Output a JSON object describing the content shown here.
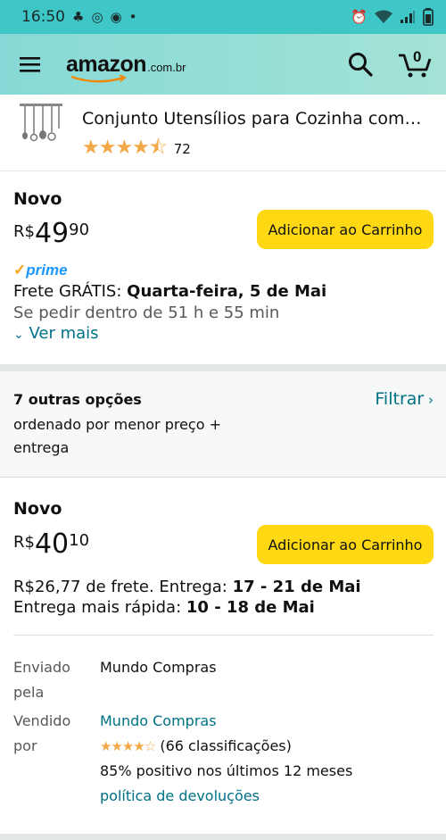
{
  "status_bar": {
    "time": "16:50"
  },
  "header": {
    "logo_main": "amazon",
    "logo_tld": ".com.br",
    "cart_count": "0"
  },
  "product": {
    "title": "Conjunto Utensílios para Cozinha com…",
    "rating_stars": "★★★★⯪",
    "rating_count": "72"
  },
  "offer1": {
    "condition": "Novo",
    "price_currency": "R$",
    "price_whole": "49",
    "price_fraction": "90",
    "cart_button": "Adicionar ao Carrinho",
    "prime_label": "prime",
    "shipping_prefix": "Frete GRÁTIS: ",
    "shipping_date": "Quarta-feira, 5 de Mai",
    "cutoff": "Se pedir dentro de 51 h e 55 min",
    "see_more": "Ver mais"
  },
  "other_options": {
    "title": "7 outras opções",
    "subtitle": "ordenado por menor preço + entrega",
    "filter": "Filtrar"
  },
  "offer2": {
    "condition": "Novo",
    "price_currency": "R$",
    "price_whole": "40",
    "price_fraction": "10",
    "cart_button": "Adicionar ao Carrinho",
    "shipping_prefix": "R$26,77 de frete. Entrega: ",
    "shipping_dates": "17 - 21 de Mai",
    "fast_prefix": "Entrega mais rápida: ",
    "fast_dates": "10 - 18 de Mai",
    "shipped_by_label": "Enviado pela",
    "shipped_by": "Mundo Compras",
    "sold_by_label": "Vendido por",
    "sold_by": "Mundo Compras",
    "seller_stars": "★★★★☆",
    "seller_ratings": "(66 classificações)",
    "seller_positive": "85% positivo nos últimos 12 meses",
    "returns_link": "política de devoluções"
  },
  "colors": {
    "accent_teal": "#3fc6c6",
    "button_yellow": "#ffd814",
    "link": "#007185",
    "star": "#f3a847",
    "prime_blue": "#1a98ff"
  }
}
